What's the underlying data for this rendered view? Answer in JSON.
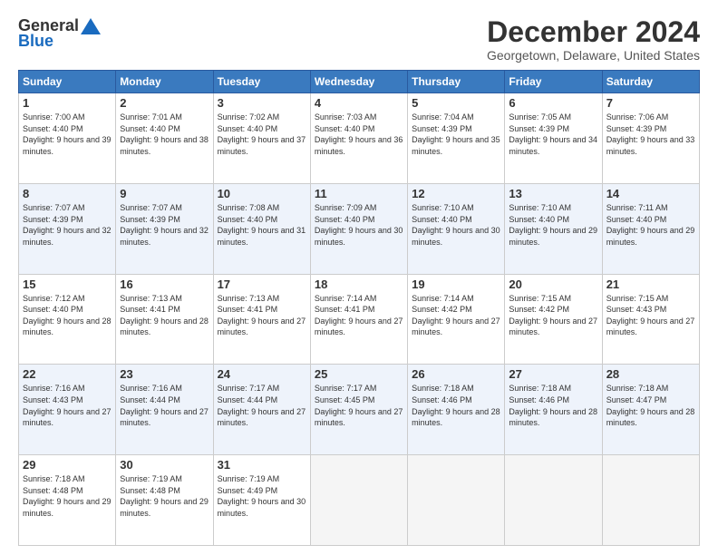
{
  "header": {
    "logo_line1": "General",
    "logo_line2": "Blue",
    "month": "December 2024",
    "location": "Georgetown, Delaware, United States"
  },
  "weekdays": [
    "Sunday",
    "Monday",
    "Tuesday",
    "Wednesday",
    "Thursday",
    "Friday",
    "Saturday"
  ],
  "weeks": [
    [
      {
        "day": "1",
        "rise": "7:00 AM",
        "set": "4:40 PM",
        "daylight": "9 hours and 39 minutes."
      },
      {
        "day": "2",
        "rise": "7:01 AM",
        "set": "4:40 PM",
        "daylight": "9 hours and 38 minutes."
      },
      {
        "day": "3",
        "rise": "7:02 AM",
        "set": "4:40 PM",
        "daylight": "9 hours and 37 minutes."
      },
      {
        "day": "4",
        "rise": "7:03 AM",
        "set": "4:40 PM",
        "daylight": "9 hours and 36 minutes."
      },
      {
        "day": "5",
        "rise": "7:04 AM",
        "set": "4:39 PM",
        "daylight": "9 hours and 35 minutes."
      },
      {
        "day": "6",
        "rise": "7:05 AM",
        "set": "4:39 PM",
        "daylight": "9 hours and 34 minutes."
      },
      {
        "day": "7",
        "rise": "7:06 AM",
        "set": "4:39 PM",
        "daylight": "9 hours and 33 minutes."
      }
    ],
    [
      {
        "day": "8",
        "rise": "7:07 AM",
        "set": "4:39 PM",
        "daylight": "9 hours and 32 minutes."
      },
      {
        "day": "9",
        "rise": "7:07 AM",
        "set": "4:39 PM",
        "daylight": "9 hours and 32 minutes."
      },
      {
        "day": "10",
        "rise": "7:08 AM",
        "set": "4:40 PM",
        "daylight": "9 hours and 31 minutes."
      },
      {
        "day": "11",
        "rise": "7:09 AM",
        "set": "4:40 PM",
        "daylight": "9 hours and 30 minutes."
      },
      {
        "day": "12",
        "rise": "7:10 AM",
        "set": "4:40 PM",
        "daylight": "9 hours and 30 minutes."
      },
      {
        "day": "13",
        "rise": "7:10 AM",
        "set": "4:40 PM",
        "daylight": "9 hours and 29 minutes."
      },
      {
        "day": "14",
        "rise": "7:11 AM",
        "set": "4:40 PM",
        "daylight": "9 hours and 29 minutes."
      }
    ],
    [
      {
        "day": "15",
        "rise": "7:12 AM",
        "set": "4:40 PM",
        "daylight": "9 hours and 28 minutes."
      },
      {
        "day": "16",
        "rise": "7:13 AM",
        "set": "4:41 PM",
        "daylight": "9 hours and 28 minutes."
      },
      {
        "day": "17",
        "rise": "7:13 AM",
        "set": "4:41 PM",
        "daylight": "9 hours and 27 minutes."
      },
      {
        "day": "18",
        "rise": "7:14 AM",
        "set": "4:41 PM",
        "daylight": "9 hours and 27 minutes."
      },
      {
        "day": "19",
        "rise": "7:14 AM",
        "set": "4:42 PM",
        "daylight": "9 hours and 27 minutes."
      },
      {
        "day": "20",
        "rise": "7:15 AM",
        "set": "4:42 PM",
        "daylight": "9 hours and 27 minutes."
      },
      {
        "day": "21",
        "rise": "7:15 AM",
        "set": "4:43 PM",
        "daylight": "9 hours and 27 minutes."
      }
    ],
    [
      {
        "day": "22",
        "rise": "7:16 AM",
        "set": "4:43 PM",
        "daylight": "9 hours and 27 minutes."
      },
      {
        "day": "23",
        "rise": "7:16 AM",
        "set": "4:44 PM",
        "daylight": "9 hours and 27 minutes."
      },
      {
        "day": "24",
        "rise": "7:17 AM",
        "set": "4:44 PM",
        "daylight": "9 hours and 27 minutes."
      },
      {
        "day": "25",
        "rise": "7:17 AM",
        "set": "4:45 PM",
        "daylight": "9 hours and 27 minutes."
      },
      {
        "day": "26",
        "rise": "7:18 AM",
        "set": "4:46 PM",
        "daylight": "9 hours and 28 minutes."
      },
      {
        "day": "27",
        "rise": "7:18 AM",
        "set": "4:46 PM",
        "daylight": "9 hours and 28 minutes."
      },
      {
        "day": "28",
        "rise": "7:18 AM",
        "set": "4:47 PM",
        "daylight": "9 hours and 28 minutes."
      }
    ],
    [
      {
        "day": "29",
        "rise": "7:18 AM",
        "set": "4:48 PM",
        "daylight": "9 hours and 29 minutes."
      },
      {
        "day": "30",
        "rise": "7:19 AM",
        "set": "4:48 PM",
        "daylight": "9 hours and 29 minutes."
      },
      {
        "day": "31",
        "rise": "7:19 AM",
        "set": "4:49 PM",
        "daylight": "9 hours and 30 minutes."
      },
      null,
      null,
      null,
      null
    ]
  ]
}
